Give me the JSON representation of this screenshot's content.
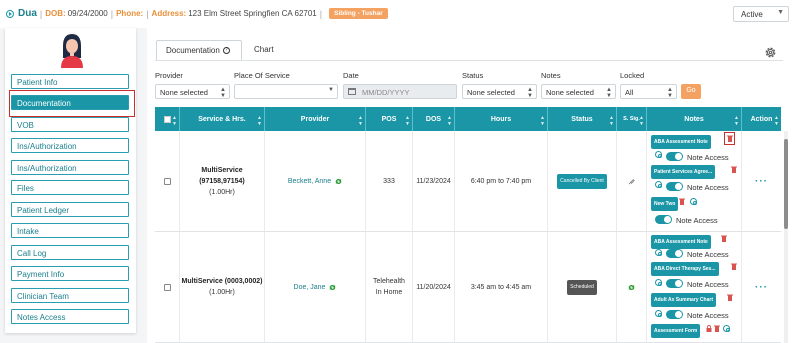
{
  "header": {
    "patient_name": "Dua",
    "dob_label": "DOB:",
    "dob": "09/24/2000",
    "phone_label": "Phone:",
    "address_label": "Address:",
    "address": "123 Elm Street Springfien CA 62701",
    "sibling_badge": "Sibling - Tushar",
    "status_value": "Active"
  },
  "sidebar": {
    "items": [
      {
        "label": "Patient Info"
      },
      {
        "label": "Documentation"
      },
      {
        "label": "VOB"
      },
      {
        "label": "Ins/Authorization"
      },
      {
        "label": "Ins/Authorization"
      },
      {
        "label": "Files"
      },
      {
        "label": "Patient Ledger"
      },
      {
        "label": "Intake"
      },
      {
        "label": "Call Log"
      },
      {
        "label": "Payment Info"
      },
      {
        "label": "Clinician Team"
      },
      {
        "label": "Notes Access"
      }
    ],
    "active_index": 1
  },
  "tabs": [
    {
      "label": "Documentation"
    },
    {
      "label": "Chart"
    }
  ],
  "filters": {
    "provider_label": "Provider",
    "provider_value": "None selected",
    "pos_label": "Place Of Service",
    "pos_value": "",
    "date_label": "Date",
    "date_placeholder": "MM/DD/YYYY",
    "status_label": "Status",
    "status_value": "None selected",
    "notes_label": "Notes",
    "notes_value": "None selected",
    "locked_label": "Locked",
    "locked_value": "All",
    "go_label": "Go"
  },
  "table": {
    "headers": [
      "Service & Hrs.",
      "Provider",
      "POS",
      "DOS",
      "Hours",
      "Status",
      "S. Sig.",
      "Notes",
      "Action"
    ],
    "rows": [
      {
        "service": "MultiService (97158,97154)",
        "hrs": "(1.00Hr)",
        "provider": "Beckett, Anne",
        "pos": "333",
        "dos": "11/23/2024",
        "hours": "6:40 pm to 7:40 pm",
        "status": "Cancelled By Client",
        "notes": [
          {
            "tag": "ABA Assessment Note"
          },
          {
            "tag": "Patient Services Agree..."
          },
          {
            "tag": "New Two"
          }
        ],
        "note_access": "Note Access",
        "action": "···"
      },
      {
        "service": "MultiService (0003,0002)",
        "hrs": "(1.00Hr)",
        "provider": "Doe, Jane",
        "pos": "Telehealth In Home",
        "dos": "11/20/2024",
        "hours": "3:45 am to 4:45 am",
        "status": "Scheduled",
        "notes": [
          {
            "tag": "ABA Assessment Note"
          },
          {
            "tag": "ABA Direct Therapy Ses..."
          },
          {
            "tag": "Adult Ax Summary Chart"
          },
          {
            "tag": "Assessment Form"
          }
        ],
        "note_access": "Note Access",
        "action": "···"
      }
    ]
  },
  "colors": {
    "primary": "#1b96a6",
    "accent_orange": "#f4a261",
    "danger": "#c9302c"
  },
  "icons": [
    "play-circle-icon",
    "gear-icon",
    "help-icon",
    "calendar-icon",
    "sync-icon",
    "trash-icon",
    "settings-icon",
    "lock-icon",
    "more-icon",
    "avatar-icon"
  ]
}
